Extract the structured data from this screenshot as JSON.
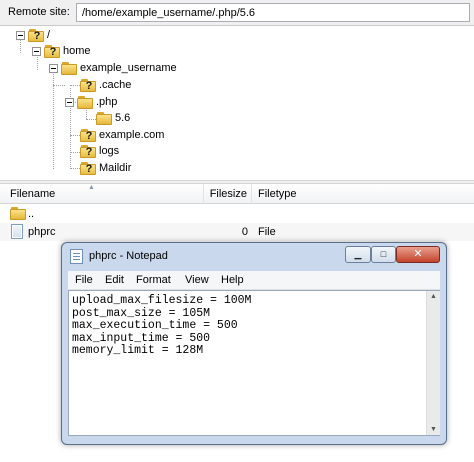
{
  "remote": {
    "label": "Remote site:",
    "path": "/home/example_username/.php/5.6"
  },
  "tree": {
    "nodes": [
      {
        "label": "/",
        "icon": "question-folder-icon"
      },
      {
        "label": "home",
        "icon": "question-folder-icon"
      },
      {
        "label": "example_username",
        "icon": "folder-icon"
      },
      {
        "label": ".cache",
        "icon": "question-folder-icon"
      },
      {
        "label": ".php",
        "icon": "folder-icon"
      },
      {
        "label": "5.6",
        "icon": "folder-icon"
      },
      {
        "label": "example.com",
        "icon": "question-folder-icon"
      },
      {
        "label": "logs",
        "icon": "question-folder-icon"
      },
      {
        "label": "Maildir",
        "icon": "question-folder-icon"
      }
    ]
  },
  "filelist": {
    "columns": {
      "name": "Filename",
      "size": "Filesize",
      "type": "Filetype"
    },
    "rows": [
      {
        "name": "..",
        "size": "",
        "type": ""
      },
      {
        "name": "phprc",
        "size": "0",
        "type": "File"
      }
    ]
  },
  "notepad": {
    "title": "phprc - Notepad",
    "menu": [
      "File",
      "Edit",
      "Format",
      "View",
      "Help"
    ],
    "lines": [
      "upload_max_filesize = 100M",
      "post_max_size = 105M",
      "max_execution_time = 500",
      "max_input_time = 500",
      "memory_limit = 128M"
    ],
    "buttons": {
      "minimize": "▁",
      "maximize": "□",
      "close": "✕"
    }
  }
}
